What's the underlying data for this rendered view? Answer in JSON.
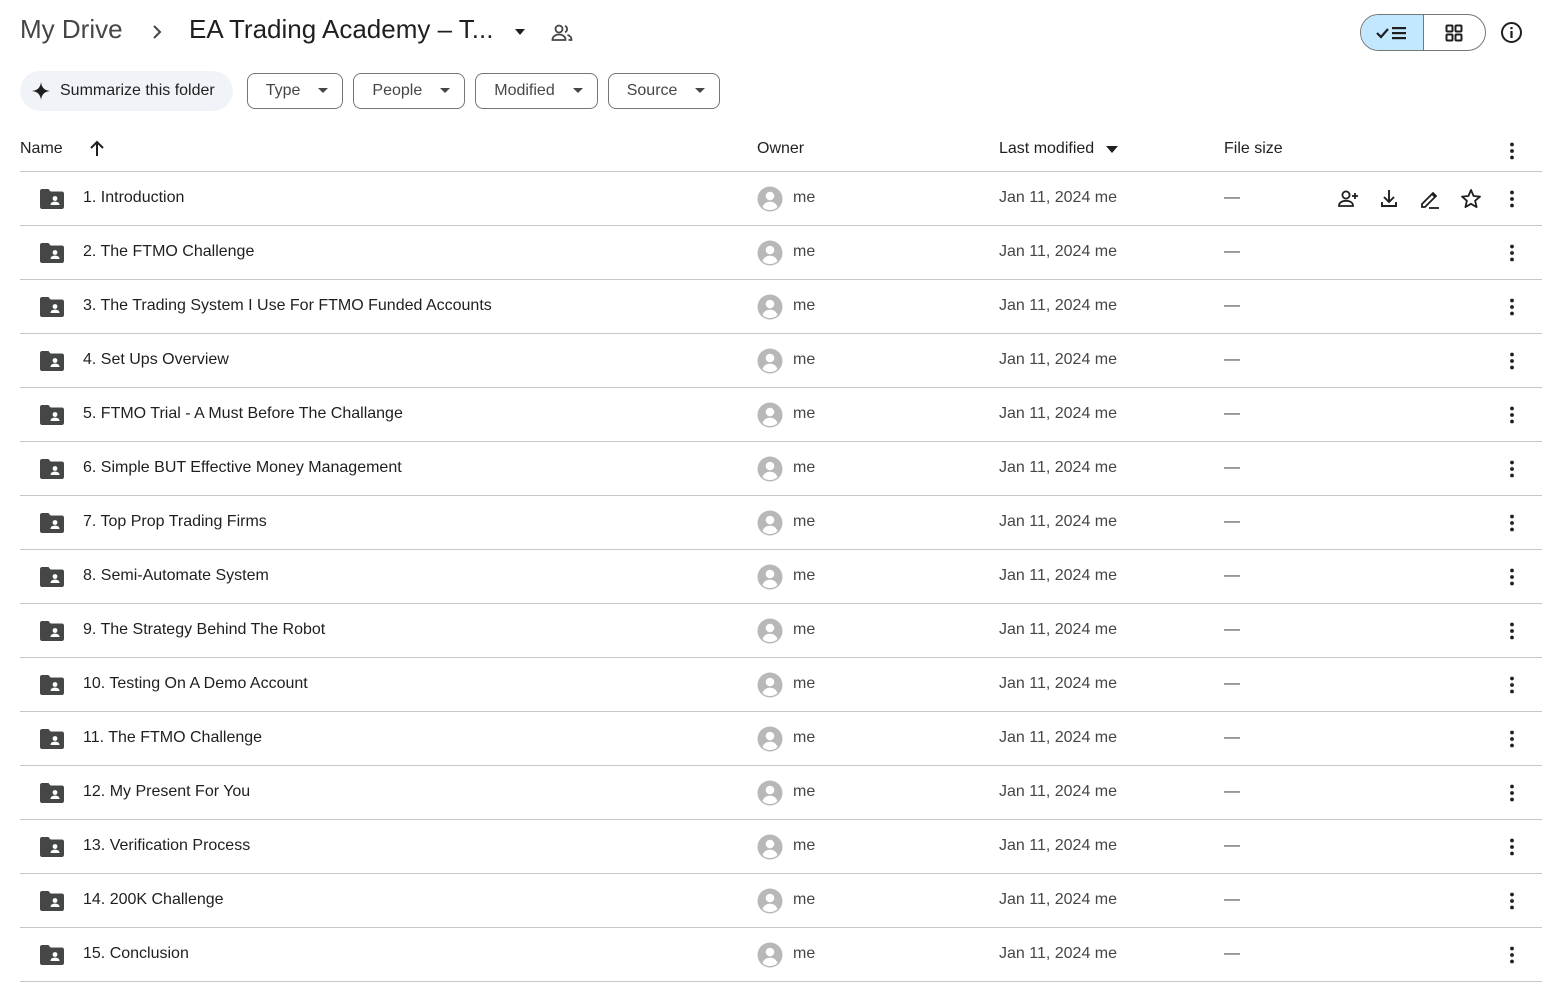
{
  "breadcrumb": {
    "root": "My Drive",
    "current": "EA Trading Academy – T..."
  },
  "toolbar": {
    "summarize_label": "Summarize this folder",
    "filters": [
      {
        "label": "Type"
      },
      {
        "label": "People"
      },
      {
        "label": "Modified"
      },
      {
        "label": "Source"
      }
    ]
  },
  "columns": {
    "name": "Name",
    "owner": "Owner",
    "last_modified": "Last modified",
    "file_size": "File size"
  },
  "icons": {
    "folder": "shared-folder-icon",
    "avatar": "avatar-icon",
    "more": "more-vert-icon",
    "share": "add-person-icon",
    "download": "download-icon",
    "rename": "rename-pen-icon",
    "star": "star-icon",
    "view_list": "list-view-icon",
    "view_grid": "grid-view-icon",
    "info": "info-icon"
  },
  "colors": {
    "accent": "#c2e7ff",
    "icon": "#444746",
    "avatar": "#b8b8b8",
    "divider": "#c7c7c7"
  },
  "rows": [
    {
      "name": "1. Introduction",
      "owner": "me",
      "modified": "Jan 11, 2024 me",
      "size": "—"
    },
    {
      "name": "2. The FTMO Challenge",
      "owner": "me",
      "modified": "Jan 11, 2024 me",
      "size": "—"
    },
    {
      "name": "3. The Trading System I Use For FTMO Funded Accounts",
      "owner": "me",
      "modified": "Jan 11, 2024 me",
      "size": "—"
    },
    {
      "name": "4. Set Ups Overview",
      "owner": "me",
      "modified": "Jan 11, 2024 me",
      "size": "—"
    },
    {
      "name": "5. FTMO Trial - A Must Before The Challange",
      "owner": "me",
      "modified": "Jan 11, 2024 me",
      "size": "—"
    },
    {
      "name": "6. Simple BUT Effective Money Management",
      "owner": "me",
      "modified": "Jan 11, 2024 me",
      "size": "—"
    },
    {
      "name": "7. Top Prop Trading Firms",
      "owner": "me",
      "modified": "Jan 11, 2024 me",
      "size": "—"
    },
    {
      "name": "8. Semi-Automate System",
      "owner": "me",
      "modified": "Jan 11, 2024 me",
      "size": "—"
    },
    {
      "name": "9. The Strategy Behind The Robot",
      "owner": "me",
      "modified": "Jan 11, 2024 me",
      "size": "—"
    },
    {
      "name": "10. Testing On A Demo Account",
      "owner": "me",
      "modified": "Jan 11, 2024 me",
      "size": "—"
    },
    {
      "name": "11. The FTMO Challenge",
      "owner": "me",
      "modified": "Jan 11, 2024 me",
      "size": "—"
    },
    {
      "name": "12. My Present For You",
      "owner": "me",
      "modified": "Jan 11, 2024 me",
      "size": "—"
    },
    {
      "name": "13. Verification Process",
      "owner": "me",
      "modified": "Jan 11, 2024 me",
      "size": "—"
    },
    {
      "name": "14. 200K Challenge",
      "owner": "me",
      "modified": "Jan 11, 2024 me",
      "size": "—"
    },
    {
      "name": "15. Conclusion",
      "owner": "me",
      "modified": "Jan 11, 2024 me",
      "size": "—"
    }
  ]
}
